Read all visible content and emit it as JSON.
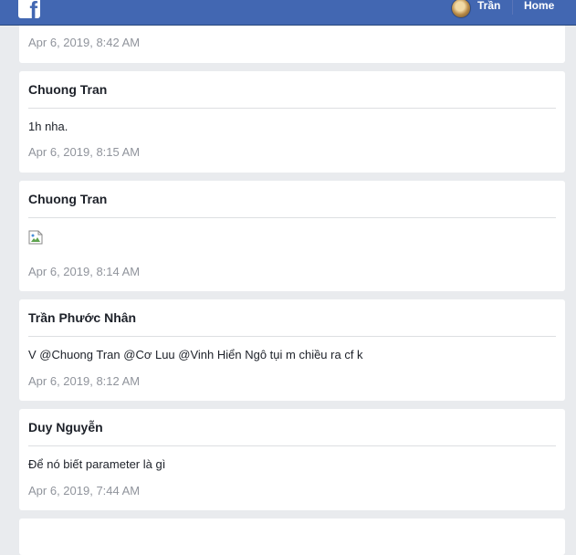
{
  "header": {
    "user_name": "Trần",
    "home_label": "Home",
    "brand_color": "#4267b2"
  },
  "messages": [
    {
      "time": "Apr 6, 2019, 8:42 AM"
    },
    {
      "author": "Chuong Tran",
      "text": "1h nha.",
      "time": "Apr 6, 2019, 8:15 AM"
    },
    {
      "author": "Chuong Tran",
      "attachment": "broken-image-icon",
      "time": "Apr 6, 2019, 8:14 AM"
    },
    {
      "author": "Trần Phước Nhân",
      "text": "V @Chuong Tran @Cơ Luu @Vinh Hiển Ngô tụi m chiều ra cf k",
      "time": "Apr 6, 2019, 8:12 AM"
    },
    {
      "author": "Duy Nguyễn",
      "text": "Để nó biết parameter là gì",
      "time": "Apr 6, 2019, 7:44 AM"
    }
  ]
}
